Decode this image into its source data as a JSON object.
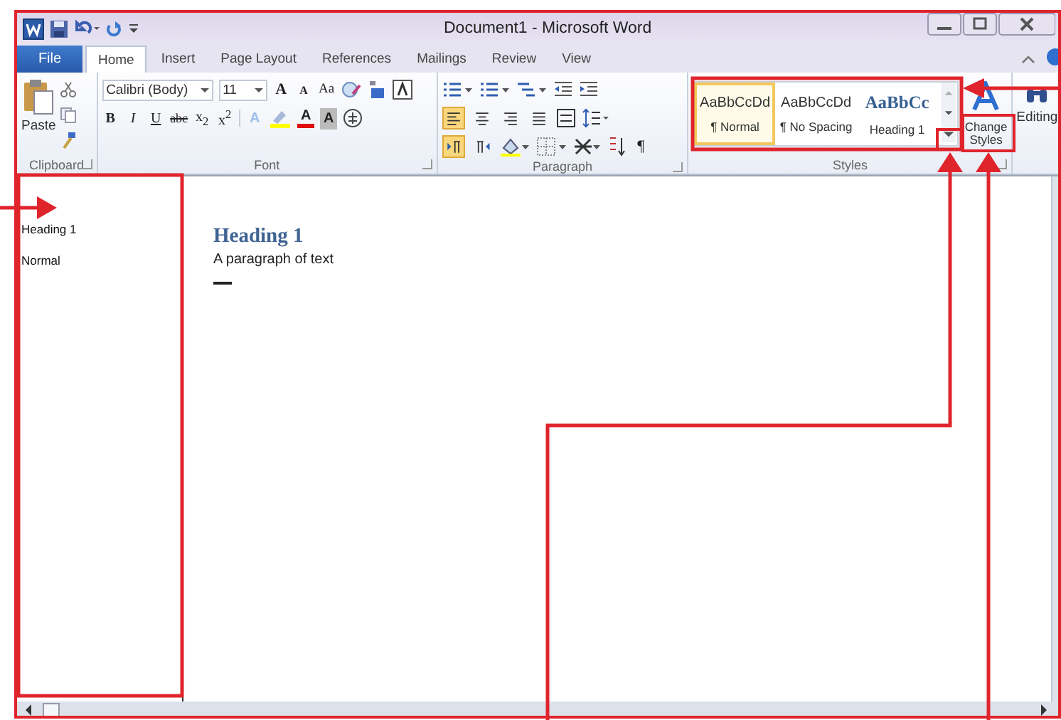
{
  "window": {
    "title": "Document1 - Microsoft Word"
  },
  "tabs": [
    {
      "label": "File",
      "kind": "file",
      "selected": false
    },
    {
      "label": "Home",
      "kind": "tab",
      "selected": true
    },
    {
      "label": "Insert",
      "kind": "tab",
      "selected": false
    },
    {
      "label": "Page Layout",
      "kind": "tab",
      "selected": false
    },
    {
      "label": "References",
      "kind": "tab",
      "selected": false
    },
    {
      "label": "Mailings",
      "kind": "tab",
      "selected": false
    },
    {
      "label": "Review",
      "kind": "tab",
      "selected": false
    },
    {
      "label": "View",
      "kind": "tab",
      "selected": false
    }
  ],
  "clipboard": {
    "label": "Clipboard",
    "paste": "Paste"
  },
  "font": {
    "label": "Font",
    "font_name": "Calibri (Body)",
    "font_size": "11",
    "top_buttons": [
      {
        "label": "A",
        "kind": "grow"
      },
      {
        "label": "A",
        "kind": "shrink"
      },
      {
        "label": "Aa",
        "kind": "case"
      }
    ],
    "format_buttons": [
      {
        "label": "B",
        "kind": "bold"
      },
      {
        "label": "I",
        "kind": "italic"
      },
      {
        "label": "U",
        "kind": "underline"
      },
      {
        "label": "abc",
        "kind": "strike"
      },
      {
        "label": "x$_{2}$",
        "kind": "script"
      },
      {
        "label": "x$^{2}$",
        "kind": "script"
      }
    ],
    "color_buttons": [
      {
        "label": "A",
        "kind": "effects"
      },
      {
        "label": "A",
        "kind": "color"
      },
      {
        "label": "A",
        "kind": "shade"
      }
    ]
  },
  "paragraph": {
    "label": "Paragraph",
    "pilcrow": "¶",
    "alignment": [
      {
        "kind": "left",
        "selected": true
      },
      {
        "kind": "center",
        "selected": false
      },
      {
        "kind": "right",
        "selected": false
      },
      {
        "kind": "justify",
        "selected": false
      }
    ],
    "direction": [
      {
        "kind": "ltr",
        "selected": true
      },
      {
        "kind": "rtl",
        "selected": false
      }
    ]
  },
  "styles": {
    "label": "Styles",
    "items": [
      {
        "preview": "AaBbCcDd",
        "name": "¶ Normal",
        "kind": "normal",
        "selected": true
      },
      {
        "preview": "AaBbCcDd",
        "name": "¶ No Spacing",
        "kind": "normal",
        "selected": false
      },
      {
        "preview": "AaBbCc",
        "name": "Heading 1",
        "kind": "heading",
        "selected": false
      }
    ],
    "change_styles": "Change Styles"
  },
  "editing": {
    "label": "Editing"
  },
  "style_area": [
    "Heading 1",
    "Normal"
  ],
  "document": {
    "heading": "Heading 1",
    "paragraph": "A paragraph of text"
  }
}
